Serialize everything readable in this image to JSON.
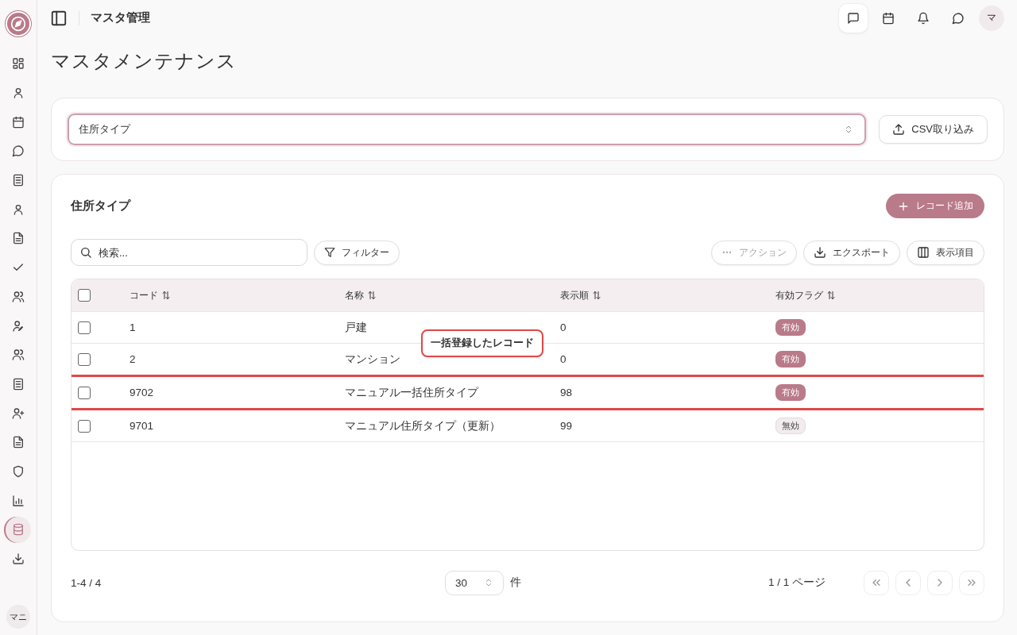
{
  "sidebar": {
    "items": [
      {
        "selected": false
      },
      {
        "selected": false
      },
      {
        "selected": false
      },
      {
        "selected": false
      },
      {
        "selected": false
      },
      {
        "selected": false
      },
      {
        "selected": false
      },
      {
        "selected": false
      },
      {
        "selected": false
      },
      {
        "selected": false
      },
      {
        "selected": false
      },
      {
        "selected": false
      },
      {
        "selected": false
      },
      {
        "selected": false
      },
      {
        "selected": false
      },
      {
        "selected": false
      },
      {
        "selected": true
      },
      {
        "selected": false
      }
    ],
    "user_avatar": "マニ"
  },
  "header": {
    "title": "マスタ管理",
    "avatar": "マ"
  },
  "page_title": "マスタメンテナンス",
  "master_select": {
    "value": "住所タイプ"
  },
  "csv_button": "CSV取り込み",
  "section": {
    "title": "住所タイプ",
    "add_button": "レコード追加"
  },
  "search": {
    "placeholder": "検索..."
  },
  "filter_button": "フィルター",
  "action_button": {
    "label": "アクション",
    "disabled": true
  },
  "export_button": "エクスポート",
  "columns_button": "表示項目",
  "table": {
    "select_all": {
      "checked": false
    },
    "columns": [
      "コード",
      "名称",
      "表示順",
      "有効フラグ"
    ],
    "rows": [
      {
        "checked": false,
        "highlighted": false,
        "code": "1",
        "name": "戸建",
        "order": "0",
        "flag": {
          "label": "有効",
          "active": true
        }
      },
      {
        "checked": false,
        "highlighted": false,
        "code": "2",
        "name": "マンション",
        "order": "0",
        "flag": {
          "label": "有効",
          "active": true
        }
      },
      {
        "checked": false,
        "highlighted": true,
        "code": "9702",
        "name": "マニュアル一括住所タイプ",
        "order": "98",
        "flag": {
          "label": "有効",
          "active": true
        }
      },
      {
        "checked": false,
        "highlighted": false,
        "code": "9701",
        "name": "マニュアル住所タイプ（更新）",
        "order": "99",
        "flag": {
          "label": "無効",
          "active": false
        }
      }
    ]
  },
  "callout": "一括登録したレコード",
  "pagination": {
    "range": "1-4 / 4",
    "page_size": "30",
    "unit": "件",
    "page": "1 / 1 ページ"
  }
}
